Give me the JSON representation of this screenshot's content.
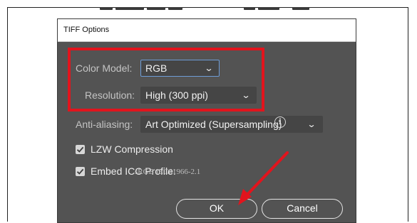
{
  "dialog": {
    "title": "TIFF Options",
    "color_model": {
      "label": "Color Model:",
      "value": "RGB"
    },
    "resolution": {
      "label": "Resolution:",
      "value": "High (300 ppi)"
    },
    "anti_aliasing": {
      "label": "Anti-aliasing:",
      "value": "Art Optimized (Supersampling)"
    },
    "lzw_compression": {
      "label": "LZW Compression",
      "checked": true
    },
    "embed_icc": {
      "label": "Embed ICC Profile:",
      "checked": true,
      "profile": "sRGB IEC61966-2.1"
    },
    "buttons": {
      "ok": "OK",
      "cancel": "Cancel"
    }
  },
  "icons": {
    "info": "info-icon",
    "info_glyph": "i",
    "chevron": "chevron-down-icon",
    "chevron_glyph": "⌄",
    "check": "checkmark-icon"
  },
  "colors": {
    "dialog_bg": "#535353",
    "highlight": "#e2141d",
    "arrow": "#e2141d",
    "focus": "#6e9cd6"
  }
}
